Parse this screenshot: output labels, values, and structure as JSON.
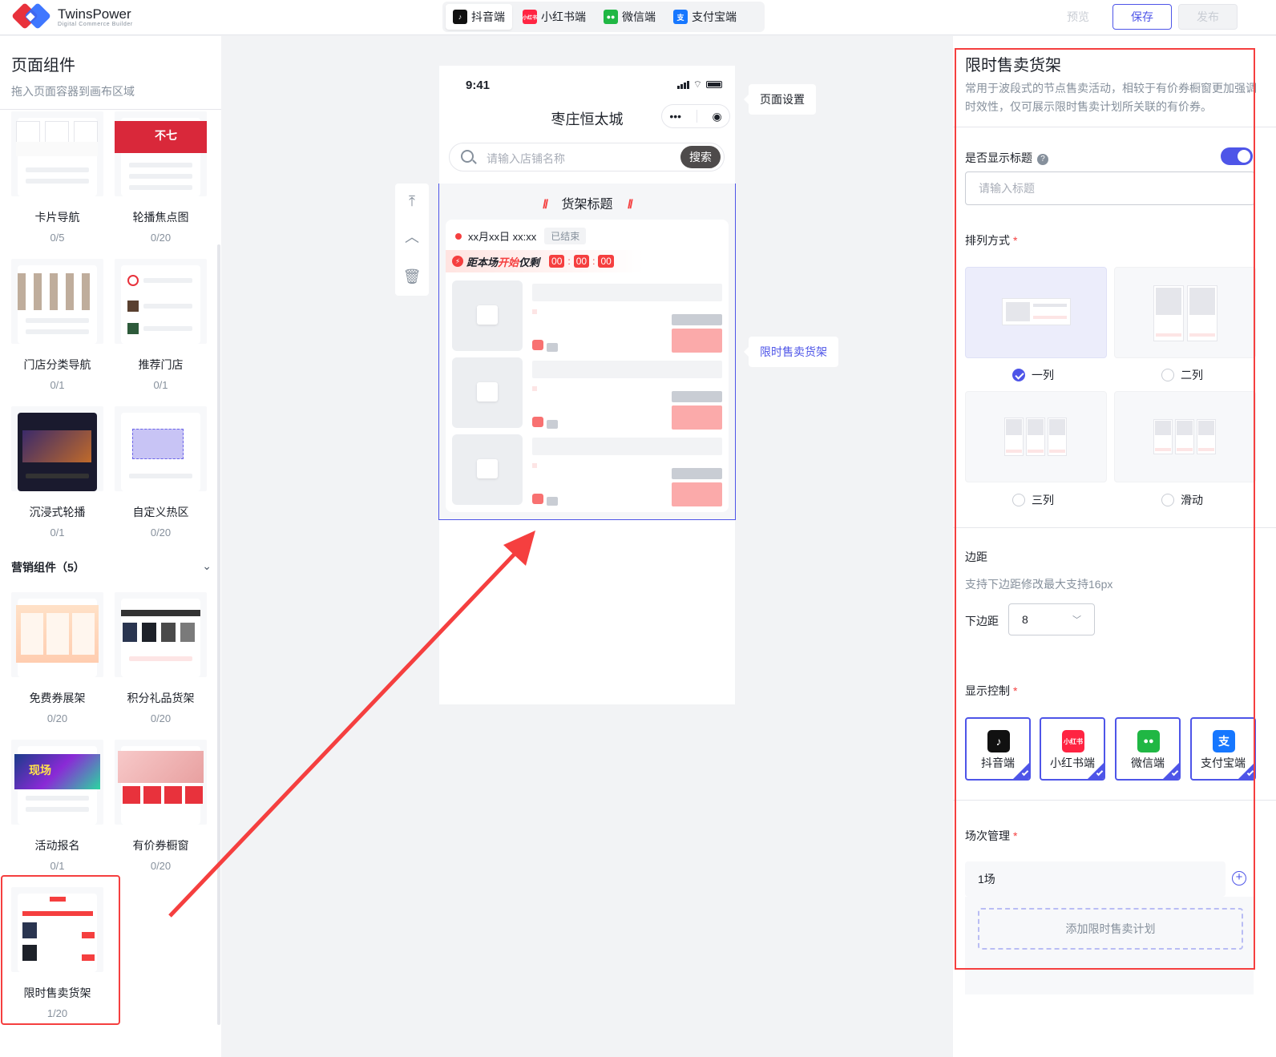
{
  "brand": {
    "name": "TwinsPower",
    "subtitle": "Digital Commerce Builder"
  },
  "platform_tabs": [
    {
      "label": "抖音端",
      "icon": "douyin-icon",
      "active": true
    },
    {
      "label": "小红书端",
      "icon": "xiaohongshu-icon",
      "active": false
    },
    {
      "label": "微信端",
      "icon": "wechat-icon",
      "active": false
    },
    {
      "label": "支付宝端",
      "icon": "alipay-icon",
      "active": false
    }
  ],
  "actions": {
    "preview": "预览",
    "save": "保存",
    "publish": "发布"
  },
  "left_panel": {
    "title": "页面组件",
    "subtitle": "拖入页面容器到画布区域",
    "components": [
      {
        "name": "卡片导航",
        "count": "0/5"
      },
      {
        "name": "轮播焦点图",
        "count": "0/20"
      },
      {
        "name": "门店分类导航",
        "count": "0/1"
      },
      {
        "name": "推荐门店",
        "count": "0/1"
      },
      {
        "name": "沉浸式轮播",
        "count": "0/1"
      },
      {
        "name": "自定义热区",
        "count": "0/20"
      }
    ],
    "marketing_group": "营销组件（5）",
    "marketing_components": [
      {
        "name": "免费券展架",
        "count": "0/20"
      },
      {
        "name": "积分礼品货架",
        "count": "0/20"
      },
      {
        "name": "活动报名",
        "count": "0/1"
      },
      {
        "name": "有价券橱窗",
        "count": "0/20"
      },
      {
        "name": "限时售卖货架",
        "count": "1/20"
      }
    ]
  },
  "phone": {
    "time": "9:41",
    "title": "枣庄恒太城",
    "search_placeholder": "请输入店铺名称",
    "search_button": "搜索",
    "shelf_title": "货架标题",
    "shelf_title_deco": "//",
    "session_time": "xx月xx日  xx:xx",
    "session_status": "已结束",
    "countdown_label_a": "距本场",
    "countdown_label_hot": "开始",
    "countdown_label_b": "仅剩",
    "countdown": [
      "00",
      "00",
      "00"
    ]
  },
  "canvas_tooltips": {
    "page_settings": "页面设置",
    "shelf": "限时售卖货架"
  },
  "right_panel": {
    "title": "限时售卖货架",
    "description": "常用于波段式的节点售卖活动，相较于有价券橱窗更加强调时效性，仅可展示限时售卖计划所关联的有价券。",
    "show_title_label": "是否显示标题",
    "show_title_on": true,
    "title_placeholder": "请输入标题",
    "layout_label": "排列方式",
    "layout_options": [
      {
        "label": "一列",
        "selected": true
      },
      {
        "label": "二列",
        "selected": false
      },
      {
        "label": "三列",
        "selected": false
      },
      {
        "label": "滑动",
        "selected": false
      }
    ],
    "margin_label": "边距",
    "margin_hint": "支持下边距修改最大支持16px",
    "bottom_margin_label": "下边距",
    "bottom_margin_value": "8",
    "display_control_label": "显示控制",
    "display_platforms": [
      {
        "label": "抖音端",
        "icon": "douyin-icon",
        "checked": true
      },
      {
        "label": "小红书端",
        "icon": "xiaohongshu-icon",
        "checked": true
      },
      {
        "label": "微信端",
        "icon": "wechat-icon",
        "checked": true
      },
      {
        "label": "支付宝端",
        "icon": "alipay-icon",
        "checked": true
      }
    ],
    "session_label": "场次管理",
    "session_name": "1场",
    "add_plan": "添加限时售卖计划"
  },
  "colors": {
    "accent": "#4e55e8",
    "highlight": "#f53f3f",
    "douyin": "#111111",
    "xiaohongshu": "#ff2442",
    "wechat": "#20b744",
    "alipay": "#1677ff"
  }
}
